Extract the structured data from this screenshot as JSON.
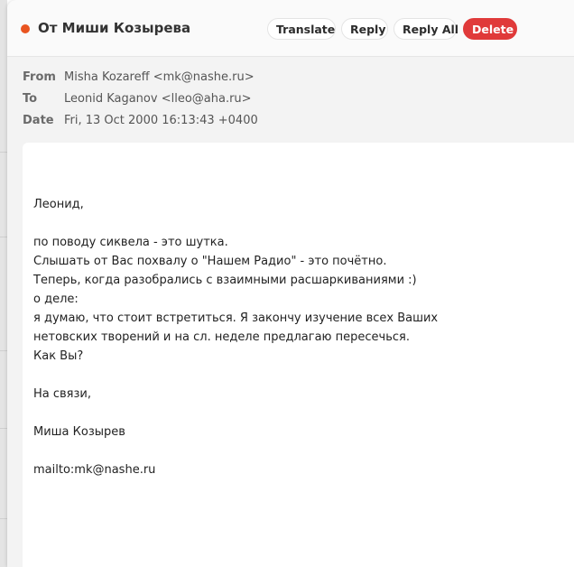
{
  "window": {
    "title": "От Миши Козырева",
    "accent_color": "#e95420"
  },
  "toolbar": {
    "translate_label": "Translate",
    "reply_label": "Reply",
    "reply_all_label": "Reply All",
    "delete_label": "Delete",
    "delete_color": "#e03a3a"
  },
  "headers": [
    {
      "label": "From",
      "value": "Misha Kozareff <mk@nashe.ru>"
    },
    {
      "label": "To",
      "value": "Leonid Kaganov <lleo@aha.ru>"
    },
    {
      "label": "Date",
      "value": "Fri, 13 Oct 2000 16:13:43 +0400"
    }
  ],
  "body": {
    "lines": [
      "Леонид,",
      "",
      "по поводу сиквела - это шутка.",
      "Слышать от Вас похвалу о \"Нашем Радио\" - это почётно.",
      "Теперь, когда разобрались с взаимными расшаркиваниями :)",
      "о деле:",
      "я думаю, что стоит встретиться. Я закончу изучение всех Ваших",
      "нетовских творений и на сл. неделе предлагаю пересечься.",
      "Как Вы?",
      "",
      "На связи,",
      "",
      "Миша Козырев",
      "",
      "mailto:mk@nashe.ru"
    ]
  }
}
